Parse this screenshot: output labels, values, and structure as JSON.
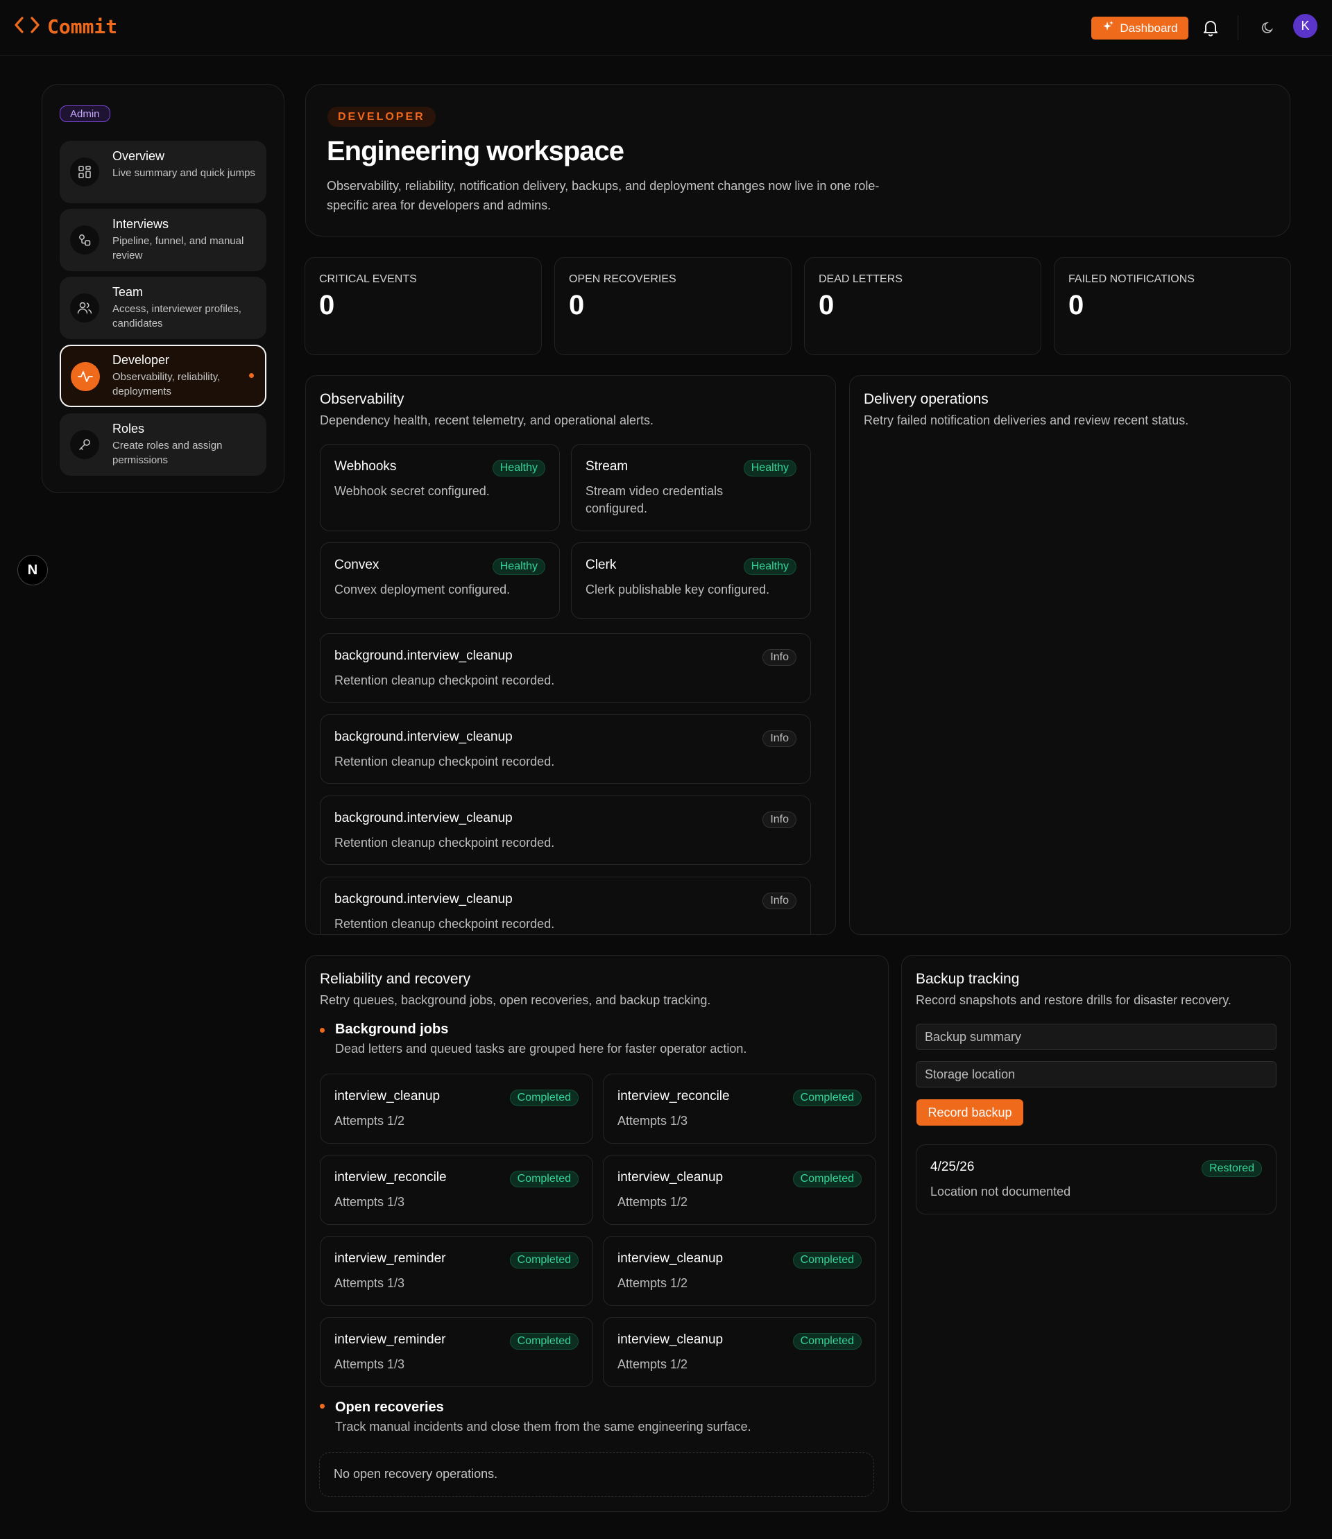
{
  "topbar": {
    "brand": "Commit",
    "dashboard_label": "Dashboard",
    "avatar_initial": "K",
    "icons": [
      "code-brackets-icon",
      "sparkle-icon",
      "bell-icon",
      "moon-icon"
    ]
  },
  "sidebar": {
    "role_badge": "Admin",
    "items": [
      {
        "label": "Overview",
        "desc": "Live summary and quick jumps",
        "icon": "grid-icon"
      },
      {
        "label": "Interviews",
        "desc": "Pipeline, funnel, and manual review",
        "icon": "pipeline-icon"
      },
      {
        "label": "Team",
        "desc": "Access, interviewer profiles, candidates",
        "icon": "users-icon"
      },
      {
        "label": "Developer",
        "desc": "Observability, reliability, deployments",
        "icon": "activity-icon",
        "active": true
      },
      {
        "label": "Roles",
        "desc": "Create roles and assign permissions",
        "icon": "key-icon"
      }
    ],
    "floating_logo": "N"
  },
  "hero": {
    "eyebrow": "DEVELOPER",
    "title": "Engineering workspace",
    "description": "Observability, reliability, notification delivery, backups, and deployment changes now live in one role-specific area for developers and admins."
  },
  "stats": [
    {
      "label": "CRITICAL EVENTS",
      "value": "0"
    },
    {
      "label": "OPEN RECOVERIES",
      "value": "0"
    },
    {
      "label": "DEAD LETTERS",
      "value": "0"
    },
    {
      "label": "FAILED NOTIFICATIONS",
      "value": "0"
    }
  ],
  "observability": {
    "title": "Observability",
    "subtitle": "Dependency health, recent telemetry, and operational alerts.",
    "services": [
      {
        "name": "Webhooks",
        "status": "Healthy",
        "detail": "Webhook secret configured."
      },
      {
        "name": "Stream",
        "status": "Healthy",
        "detail": "Stream video credentials configured."
      },
      {
        "name": "Convex",
        "status": "Healthy",
        "detail": "Convex deployment configured."
      },
      {
        "name": "Clerk",
        "status": "Healthy",
        "detail": "Clerk publishable key configured."
      }
    ],
    "events": [
      {
        "name": "background.interview_cleanup",
        "level": "Info",
        "detail": "Retention cleanup checkpoint recorded."
      },
      {
        "name": "background.interview_cleanup",
        "level": "Info",
        "detail": "Retention cleanup checkpoint recorded."
      },
      {
        "name": "background.interview_cleanup",
        "level": "Info",
        "detail": "Retention cleanup checkpoint recorded."
      },
      {
        "name": "background.interview_cleanup",
        "level": "Info",
        "detail": "Retention cleanup checkpoint recorded."
      }
    ]
  },
  "delivery": {
    "title": "Delivery operations",
    "subtitle": "Retry failed notification deliveries and review recent status."
  },
  "reliability": {
    "title": "Reliability and recovery",
    "subtitle": "Retry queues, background jobs, open recoveries, and backup tracking.",
    "jobs_heading": "Background jobs",
    "jobs_sub": "Dead letters and queued tasks are grouped here for faster operator action.",
    "jobs": [
      {
        "name": "interview_cleanup",
        "status": "Completed",
        "attempts": "Attempts 1/2"
      },
      {
        "name": "interview_reconcile",
        "status": "Completed",
        "attempts": "Attempts 1/3"
      },
      {
        "name": "interview_reconcile",
        "status": "Completed",
        "attempts": "Attempts 1/3"
      },
      {
        "name": "interview_cleanup",
        "status": "Completed",
        "attempts": "Attempts 1/2"
      },
      {
        "name": "interview_reminder",
        "status": "Completed",
        "attempts": "Attempts 1/3"
      },
      {
        "name": "interview_cleanup",
        "status": "Completed",
        "attempts": "Attempts 1/2"
      },
      {
        "name": "interview_reminder",
        "status": "Completed",
        "attempts": "Attempts 1/3"
      },
      {
        "name": "interview_cleanup",
        "status": "Completed",
        "attempts": "Attempts 1/2"
      }
    ],
    "recoveries_heading": "Open recoveries",
    "recoveries_sub": "Track manual incidents and close them from the same engineering surface.",
    "recoveries_empty": "No open recovery operations."
  },
  "backup": {
    "title": "Backup tracking",
    "subtitle": "Record snapshots and restore drills for disaster recovery.",
    "summary_placeholder": "Backup summary",
    "location_placeholder": "Storage location",
    "record_label": "Record backup",
    "entries": [
      {
        "date": "4/25/26",
        "status": "Restored",
        "location": "Location not documented"
      }
    ]
  },
  "colors": {
    "accent": "#f06a1c",
    "healthy": "#34d399",
    "admin": "#7a46d8",
    "background": "#0a0a0a"
  }
}
